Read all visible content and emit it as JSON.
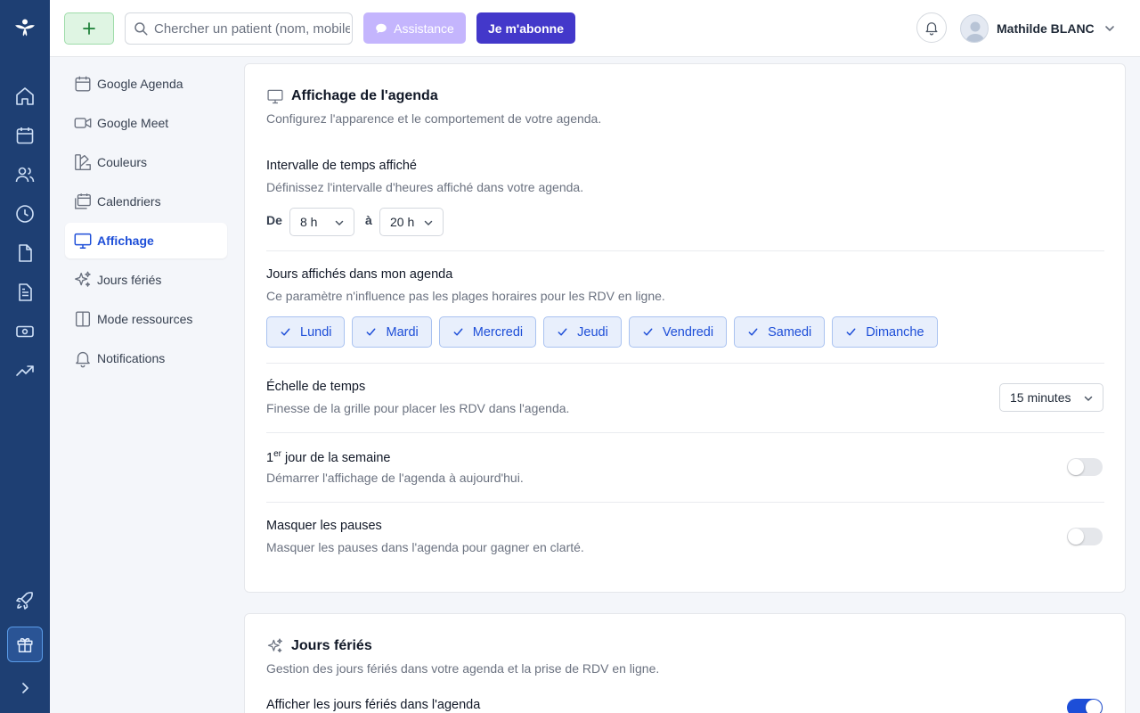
{
  "header": {
    "search_placeholder": "Chercher un patient (nom, mobile...)",
    "assist_label": "Assistance",
    "subscribe_label": "Je m'abonne",
    "user_name": "Mathilde BLANC"
  },
  "settings_nav": {
    "items": [
      {
        "label": "Google Agenda"
      },
      {
        "label": "Google Meet"
      },
      {
        "label": "Couleurs"
      },
      {
        "label": "Calendriers"
      },
      {
        "label": "Affichage"
      },
      {
        "label": "Jours fériés"
      },
      {
        "label": "Mode ressources"
      },
      {
        "label": "Notifications"
      }
    ],
    "active": "Affichage"
  },
  "display": {
    "title": "Affichage de l'agenda",
    "subtitle": "Configurez l'apparence et le comportement de votre agenda.",
    "interval": {
      "title": "Intervalle de temps affiché",
      "desc": "Définissez l'intervalle d'heures affiché dans votre agenda.",
      "from_label": "De",
      "from_value": "8 h",
      "to_label": "à",
      "to_value": "20 h"
    },
    "days": {
      "title": "Jours affichés dans mon agenda",
      "desc": "Ce paramètre n'influence pas les plages horaires pour les RDV en ligne.",
      "items": [
        "Lundi",
        "Mardi",
        "Mercredi",
        "Jeudi",
        "Vendredi",
        "Samedi",
        "Dimanche"
      ]
    },
    "scale": {
      "title": "Échelle de temps",
      "desc": "Finesse de la grille pour placer les RDV dans l'agenda.",
      "value": "15 minutes"
    },
    "first_day": {
      "title_pre": "1",
      "title_sup": "er",
      "title_post": " jour de la semaine",
      "desc": "Démarrer l'affichage de l'agenda à aujourd'hui.",
      "enabled": false
    },
    "hide_breaks": {
      "title": "Masquer les pauses",
      "desc": "Masquer les pauses dans l'agenda pour gagner en clarté.",
      "enabled": false
    }
  },
  "holidays": {
    "title": "Jours fériés",
    "subtitle": "Gestion des jours fériés dans votre agenda et la prise de RDV en ligne.",
    "show_label": "Afficher les jours fériés dans l'agenda",
    "enabled": true
  },
  "colors": {
    "rail": "#1e3f73",
    "primary": "#4338ca",
    "accent_blue": "#1d4ed8",
    "assist": "#c4b5fd",
    "add_green": "#dff5e3"
  }
}
